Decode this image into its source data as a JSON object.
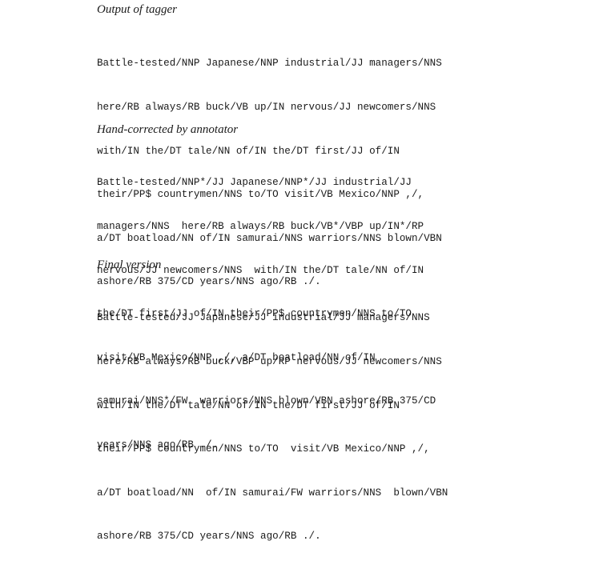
{
  "sections": [
    {
      "heading": "Output of tagger",
      "lines": [
        "Battle-tested/NNP Japanese/NNP industrial/JJ managers/NNS",
        "here/RB always/RB buck/VB up/IN nervous/JJ newcomers/NNS",
        "with/IN the/DT tale/NN of/IN the/DT first/JJ of/IN",
        "their/PP$ countrymen/NNS to/TO visit/VB Mexico/NNP ,/,",
        "a/DT boatload/NN of/IN samurai/NNS warriors/NNS blown/VBN",
        "ashore/RB 375/CD years/NNS ago/RB ./."
      ]
    },
    {
      "heading": "Hand-corrected by annotator",
      "lines": [
        "Battle-tested/NNP*/JJ Japanese/NNP*/JJ industrial/JJ",
        "managers/NNS  here/RB always/RB buck/VB*/VBP up/IN*/RP",
        "nervous/JJ newcomers/NNS  with/IN the/DT tale/NN of/IN",
        "the/DT first/JJ of/IN their/PP$ countrymen/NNS to/TO",
        "visit/VB Mexico/NNP ,/, a/DT boatload/NN of/IN",
        "samurai/NNS*/FW  warriors/NNS blown/VBN ashore/RB 375/CD",
        "years/NNS ago/RB ./."
      ]
    },
    {
      "heading": "Final version",
      "lines": [
        "Battle-tested/JJ Japanese/JJ industrial/JJ managers/NNS",
        "here/RB always/RB buck/VBP up/RP nervous/JJ newcomers/NNS",
        "with/IN the/DT tale/NN of/IN the/DT first/JJ of/IN",
        "their/PP$ countrymen/NNS to/TO  visit/VB Mexico/NNP ,/,",
        "a/DT boatload/NN  of/IN samurai/FW warriors/NNS  blown/VBN",
        "ashore/RB 375/CD years/NNS ago/RB ./."
      ]
    }
  ]
}
